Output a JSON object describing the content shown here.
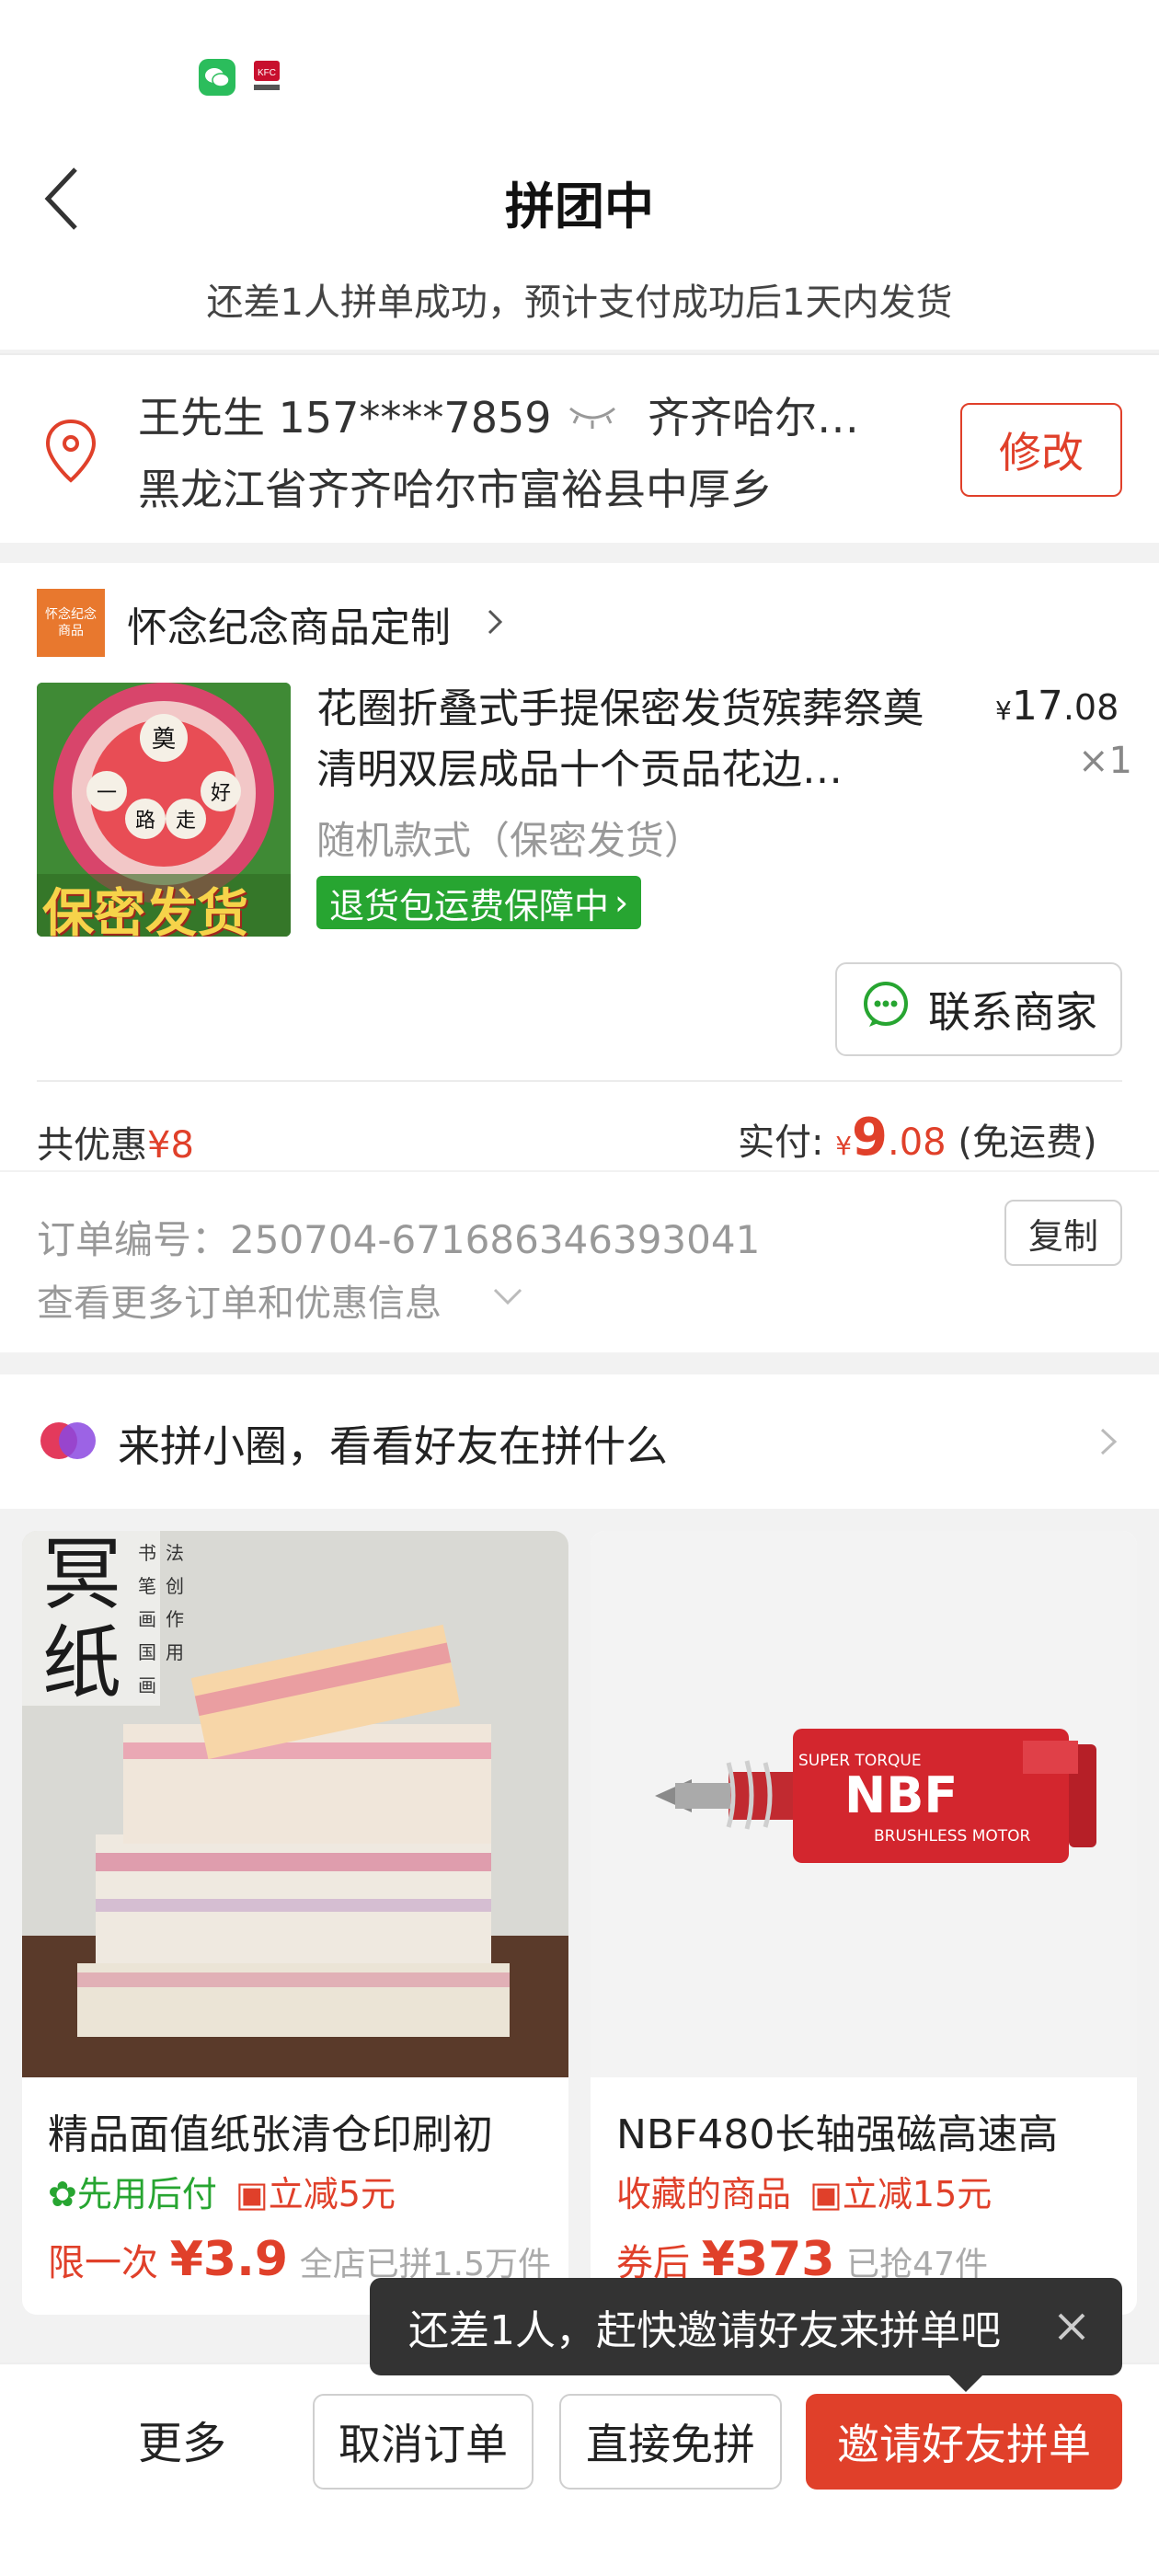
{
  "status_bar": {
    "icons": [
      "wechat-icon",
      "kfc-coffee-icon"
    ]
  },
  "header": {
    "title": "拼团中",
    "subtitle": "还差1人拼单成功，预计支付成功后1天内发货"
  },
  "address": {
    "name_phone": "王先生  157****7859",
    "city_preview": "齐齐哈尔…",
    "detail": "黑龙江省齐齐哈尔市富裕县中厚乡",
    "edit_label": "修改"
  },
  "shop": {
    "logo_text": "怀念纪念商品",
    "name": "怀念纪念商品定制"
  },
  "product": {
    "title": "花圈折叠式手提保密发货殡葬祭奠清明双层成品十个贡品花边…",
    "price_yen": "¥",
    "price_int": "17",
    "price_dec": ".08",
    "quantity": "×1",
    "variant": "随机款式（保密发货）",
    "return_badge": "退货包运费保障中",
    "image_caption": "保密发货",
    "image_chars": [
      "奠",
      "一",
      "路",
      "走",
      "好"
    ]
  },
  "contact_label": "联系商家",
  "summary": {
    "discount_label": "共优惠",
    "discount_value": "¥8",
    "paid_label": "实付: ",
    "paid_yen": "¥",
    "paid_int": "9",
    "paid_dec": ".08",
    "paid_note": " (免运费)"
  },
  "order": {
    "number": "订单编号：250704-671686346393041",
    "copy_label": "复制",
    "more_label": "查看更多订单和优惠信息"
  },
  "circle_banner": "来拼小圈，看看好友在拼什么",
  "grid": [
    {
      "title": "精品面值纸张清仓印刷初",
      "tag1": "先用后付",
      "tag2": "立减5元",
      "price_prefix": "限一次",
      "price": "¥3.9",
      "price_note": "全店已拼1.5万件",
      "image_text": "冥纸",
      "image_sub": [
        "书",
        "法",
        "笔",
        "创",
        "画",
        "作",
        "国",
        "用",
        "画"
      ]
    },
    {
      "title": "NBF480长轴强磁高速高",
      "tag1": "收藏的商品",
      "tag2": "立减15元",
      "price_prefix": "券后",
      "price": "¥373",
      "price_note": "已抢47件",
      "image_text": "NBF",
      "image_sub_top": "SUPER TORQUE",
      "image_sub_bottom": "BRUSHLESS MOTOR"
    }
  ],
  "toast": "还差1人，赶快邀请好友来拼单吧",
  "bottom": {
    "more": "更多",
    "cancel": "取消订单",
    "direct": "直接免拼",
    "invite": "邀请好友拼单"
  },
  "colors": {
    "accent": "#e0402a",
    "green": "#27a531"
  }
}
